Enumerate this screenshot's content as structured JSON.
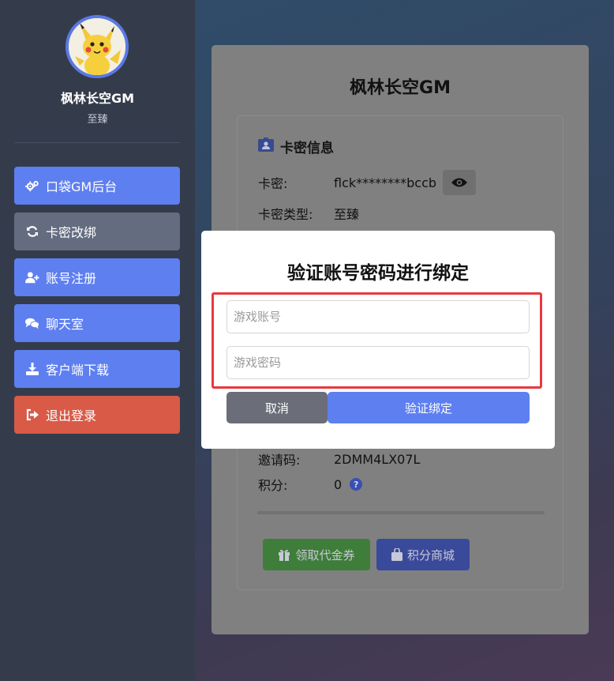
{
  "sidebar": {
    "profile_name": "枫林长空GM",
    "profile_level": "至臻",
    "items": [
      {
        "label": "口袋GM后台",
        "icon": "gears-icon"
      },
      {
        "label": "卡密改绑",
        "icon": "sync-icon"
      },
      {
        "label": "账号注册",
        "icon": "user-plus-icon"
      },
      {
        "label": "聊天室",
        "icon": "comments-icon"
      },
      {
        "label": "客户端下载",
        "icon": "download-icon"
      },
      {
        "label": "退出登录",
        "icon": "sign-out-icon"
      }
    ]
  },
  "card": {
    "title": "枫林长空GM",
    "section_title": "卡密信息",
    "rows": [
      {
        "label": "卡密:",
        "value": "flck********bccb"
      },
      {
        "label": "卡密类型:",
        "value": "至臻"
      },
      {
        "label": "邀请码:",
        "value": "2DMM4LX07L"
      },
      {
        "label": "积分:",
        "value": "0"
      }
    ],
    "help_mark": "?",
    "buttons": {
      "voucher": "领取代金券",
      "points_shop": "积分商城"
    }
  },
  "modal": {
    "title": "验证账号密码进行绑定",
    "account_placeholder": "游戏账号",
    "password_placeholder": "游戏密码",
    "cancel_label": "取消",
    "confirm_label": "验证绑定"
  },
  "colors": {
    "nav_blue": "#5e7ff0",
    "nav_active": "#646c80",
    "logout_red": "#d85a47",
    "highlight_red": "#e8383f"
  }
}
